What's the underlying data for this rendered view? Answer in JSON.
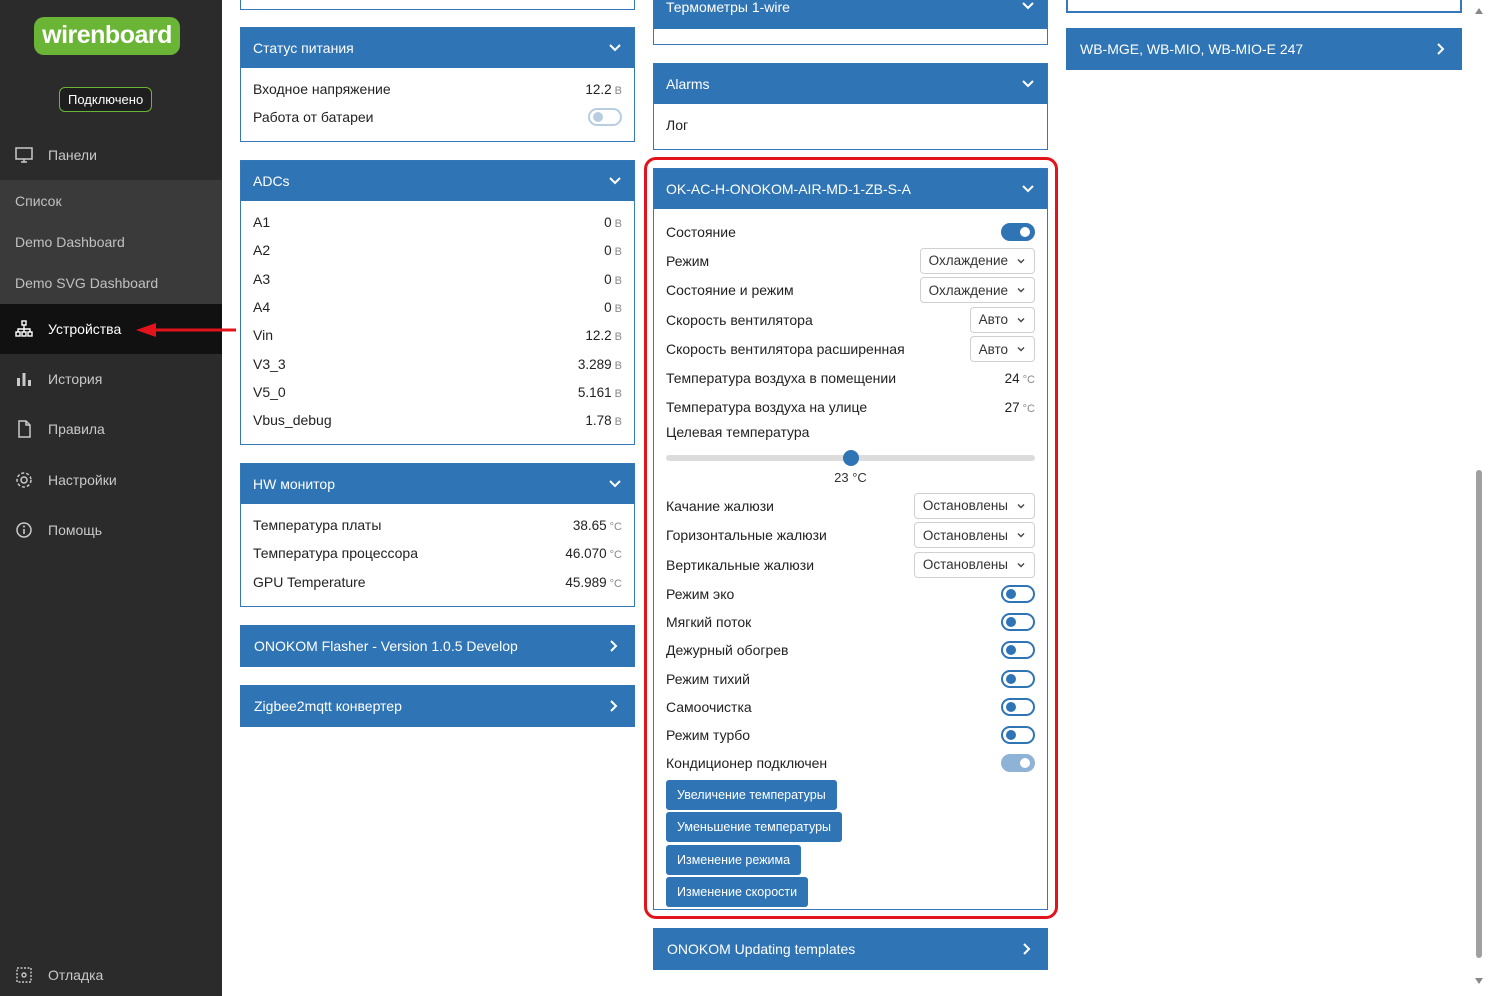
{
  "sidebar": {
    "logo": "wirenboard",
    "status": "Подключено",
    "panels_label": "Панели",
    "sub_items": [
      "Список",
      "Demo Dashboard",
      "Demo SVG Dashboard"
    ],
    "devices_label": "Устройства",
    "history_label": "История",
    "rules_label": "Правила",
    "settings_label": "Настройки",
    "help_label": "Помощь",
    "debug_label": "Отладка",
    "arrow_color": "#e3131c"
  },
  "power": {
    "title": "Статус питания",
    "rows": [
      {
        "label": "Входное напряжение",
        "value": "12.2",
        "unit": "В"
      },
      {
        "label": "Работа от батареи",
        "toggle": false
      }
    ]
  },
  "adcs": {
    "title": "ADCs",
    "rows": [
      {
        "label": "A1",
        "value": "0",
        "unit": "В"
      },
      {
        "label": "A2",
        "value": "0",
        "unit": "В"
      },
      {
        "label": "A3",
        "value": "0",
        "unit": "В"
      },
      {
        "label": "A4",
        "value": "0",
        "unit": "В"
      },
      {
        "label": "Vin",
        "value": "12.2",
        "unit": "В"
      },
      {
        "label": "V3_3",
        "value": "3.289",
        "unit": "В"
      },
      {
        "label": "V5_0",
        "value": "5.161",
        "unit": "В"
      },
      {
        "label": "Vbus_debug",
        "value": "1.78",
        "unit": "В"
      }
    ]
  },
  "hw": {
    "title": "HW монитор",
    "rows": [
      {
        "label": "Температура платы",
        "value": "38.65",
        "unit": "°C"
      },
      {
        "label": "Температура процессора",
        "value": "46.070",
        "unit": "°C"
      },
      {
        "label": "GPU Temperature",
        "value": "45.989",
        "unit": "°C"
      }
    ]
  },
  "onokom_flasher": "ONOKOM Flasher - Version 1.0.5 Develop",
  "zigbee": "Zigbee2mqtt конвертер",
  "thermometers": "Термометры 1-wire",
  "alarms": {
    "title": "Alarms",
    "log_label": "Лог"
  },
  "ac": {
    "title": "OK-AC-H-ONOKOM-AIR-MD-1-ZB-S-A",
    "state_label": "Состояние",
    "state_on": true,
    "mode_label": "Режим",
    "mode_value": "Охлаждение",
    "state_mode_label": "Состояние и режим",
    "state_mode_value": "Охлаждение",
    "fan_label": "Скорость вентилятора",
    "fan_value": "Авто",
    "fan_ext_label": "Скорость вентилятора расширенная",
    "fan_ext_value": "Авто",
    "indoor_label": "Температура воздуха в помещении",
    "indoor_value": "24",
    "outdoor_label": "Температура воздуха на улице",
    "outdoor_value": "27",
    "temp_unit": "°C",
    "target_label": "Целевая температура",
    "target_value": "23 °C",
    "target_fraction": 0.5,
    "swing_label": "Качание жалюзи",
    "swing_value": "Остановлены",
    "hswing_label": "Горизонтальные жалюзи",
    "hswing_value": "Остановлены",
    "vswing_label": "Вертикальные жалюзи",
    "vswing_value": "Остановлены",
    "toggles": [
      {
        "label": "Режим эко",
        "on": false
      },
      {
        "label": "Мягкий поток",
        "on": false
      },
      {
        "label": "Дежурный обогрев",
        "on": false
      },
      {
        "label": "Режим тихий",
        "on": false
      },
      {
        "label": "Самоочистка",
        "on": false
      },
      {
        "label": "Режим турбо",
        "on": false
      }
    ],
    "connected_label": "Кондиционер подключен",
    "connected_on": true,
    "buttons": [
      "Увеличение температуры",
      "Уменьшение температуры",
      "Изменение режима",
      "Изменение скорости"
    ]
  },
  "onokom_templates": "ONOKOM Updating templates",
  "wb_mge": "WB-MGE, WB-MIO, WB-MIO-E 247",
  "colors": {
    "header": "#2f74b5",
    "highlight": "#e3131c",
    "logo": "#6bb536"
  }
}
